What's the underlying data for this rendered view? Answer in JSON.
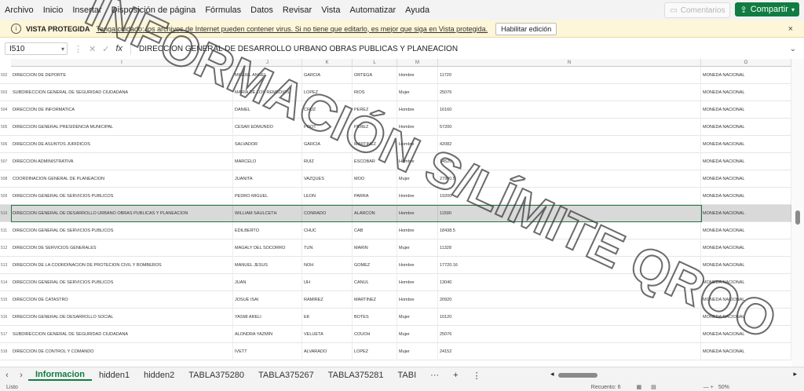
{
  "menu": [
    "Archivo",
    "Inicio",
    "Insertar",
    "Disposición de página",
    "Fórmulas",
    "Datos",
    "Revisar",
    "Vista",
    "Automatizar",
    "Ayuda"
  ],
  "comments_label": "Comentarios",
  "share_label": "Compartir",
  "protected_view": {
    "title": "VISTA PROTEGIDA",
    "message": "Tenga cuidado: los archivos de Internet pueden contener virus. Si no tiene que editarlo, es mejor que siga en Vista protegida.",
    "button": "Habilitar edición",
    "close_icon": "×"
  },
  "formula_bar": {
    "cell_ref": "I510",
    "fx": "fx",
    "value": "DIRECCION GENERAL DE DESARROLLO URBANO OBRAS PUBLICAS Y PLANEACION"
  },
  "columns": [
    {
      "letter": "I"
    },
    {
      "letter": "J"
    },
    {
      "letter": "K"
    },
    {
      "letter": "L"
    },
    {
      "letter": "M"
    },
    {
      "letter": "N"
    },
    {
      "letter": "O"
    }
  ],
  "rows": [
    {
      "num": "502",
      "cells": [
        "DIRECCION DE DEPORTE",
        "MIGUEL ANGEL",
        "GARCIA",
        "ORTEGA",
        "Hombre",
        "11720",
        "MONEDA NACIONAL"
      ]
    },
    {
      "num": "503",
      "cells": [
        "SUBDIRECCION GENERAL DE SEGURIDAD CIUDADANA",
        "MARIA DE LOS REMEDIOS",
        "LOPEZ",
        "RIOS",
        "Mujer",
        "25076",
        "MONEDA NACIONAL"
      ]
    },
    {
      "num": "504",
      "cells": [
        "DIRECCION DE INFORMATICA",
        "DANIEL",
        "CRUZ",
        "PEREZ",
        "Hombre",
        "16160",
        "MONEDA NACIONAL"
      ]
    },
    {
      "num": "505",
      "cells": [
        "DIRECCION GENERAL PRESIDENCIA MUNICIPAL",
        "CESAR EDMUNDO",
        "POOT",
        "PEREZ",
        "Hombre",
        "57200",
        "MONEDA NACIONAL"
      ]
    },
    {
      "num": "506",
      "cells": [
        "DIRECCION DE ASUNTOS JURIDICOS",
        "SALVADOR",
        "GARCIA",
        "MARTINEZ",
        "Hombre",
        "42082",
        "MONEDA NACIONAL"
      ]
    },
    {
      "num": "507",
      "cells": [
        "DIRECCION ADMINISTRATIVA",
        "MARCELO",
        "RUIZ",
        "ESCOBAR",
        "Hombre",
        "14520",
        "MONEDA NACIONAL"
      ]
    },
    {
      "num": "508",
      "cells": [
        "COORDINACION GENERAL DE PLANEACION",
        "JUANITA",
        "VAZQUES",
        "MOO",
        "Mujer",
        "27900.5",
        "MONEDA NACIONAL"
      ]
    },
    {
      "num": "509",
      "cells": [
        "DIRECCION GENERAL DE SERVICIOS PUBLICOS",
        "PEDRO MIGUEL",
        "LEON",
        "PARRA",
        "Hombre",
        "19200",
        "MONEDA NACIONAL"
      ]
    },
    {
      "num": "510",
      "selected": true,
      "cells": [
        "DIRECCION GENERAL DE DESARROLLO URBANO OBRAS PUBLICAS Y PLANEACION",
        "WILLIAM SAULCETH",
        "CONRADO",
        "ALARCON",
        "Hombre",
        "11590",
        "MONEDA NACIONAL"
      ]
    },
    {
      "num": "511",
      "cells": [
        "DIRECCION GENERAL DE SERVICIOS PUBLICOS",
        "EDILBERTO",
        "CHUC",
        "CAB",
        "Hombre",
        "18438.5",
        "MONEDA NACIONAL"
      ]
    },
    {
      "num": "512",
      "cells": [
        "DIRECCION DE SERVICIOS GENERALES",
        "MAGALY DEL SOCORRO",
        "TUN",
        "MARIN",
        "Mujer",
        "11328",
        "MONEDA NACIONAL"
      ]
    },
    {
      "num": "513",
      "cells": [
        "DIRECCION DE LA COORDINACION DE PROTECION CIVIL Y BOMBEROS",
        "MANUEL JESUS",
        "NOH",
        "GOMEZ",
        "Hombre",
        "17720.16",
        "MONEDA NACIONAL"
      ]
    },
    {
      "num": "514",
      "cells": [
        "DIRECCION GENERAL DE SERVICIOS PUBLICOS",
        "JUAN",
        "UH",
        "CANUL",
        "Hombre",
        "13040",
        "MONEDA NACIONAL"
      ]
    },
    {
      "num": "515",
      "cells": [
        "DIRECCION DE CATASTRO",
        "JOSUE ISAI",
        "RAMIREZ",
        "MARTINEZ",
        "Hombre",
        "20920",
        "MONEDA NACIONAL"
      ]
    },
    {
      "num": "516",
      "cells": [
        "DIRECCION GENERAL DE DESARROLLO SOCIAL",
        "YASMI ARELI",
        "EK",
        "BOTES",
        "Mujer",
        "10120",
        "MONEDA NACIONAL"
      ]
    },
    {
      "num": "517",
      "cells": [
        "SUBDIRECCION GENERAL DE SEGURIDAD CIUDADANA",
        "ALONDRA YAZMIN",
        "VELUETA",
        "COUOH",
        "Mujer",
        "25076",
        "MONEDA NACIONAL"
      ]
    },
    {
      "num": "518",
      "cells": [
        "DIRECCION DE CONTROL Y COMANDO",
        "IVETT",
        "ALVARADO",
        "LOPEZ",
        "Mujer",
        "24152",
        "MONEDA NACIONAL"
      ]
    }
  ],
  "watermark": "INFORMACIÓN S/LÍMITE QROO",
  "sheet_tabs": [
    "Informacion",
    "hidden1",
    "hidden2",
    "TABLA375280",
    "TABLA375267",
    "TABLA375281",
    "TABI"
  ],
  "active_tab": "Informacion",
  "tab_more": "···",
  "tab_add": "+",
  "status": {
    "left": "Listo",
    "count": "Recuento: 6",
    "zoom": "50%"
  },
  "colors": {
    "accent": "#107c41",
    "selection_border": "#217346",
    "protected_bg": "#fdf6d8",
    "watermark": "#3a3a3a"
  }
}
